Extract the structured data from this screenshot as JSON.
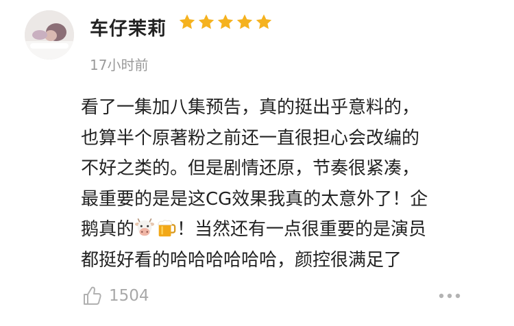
{
  "comment": {
    "username": "车仔茉莉",
    "rating": 5,
    "timestamp": "17小时前",
    "lines": [
      "看了一集加八集预告，真的挺出乎意料的，",
      "也算半个原著粉之前还一直很担心会改编的",
      "不好之类的。但是剧情还原，节奏很紧凑，",
      "最重要的是是这CG效果我真的太意外了！企"
    ],
    "line5_start": "鹅真的",
    "line5_end": "！当然还有一点很重要的是演员",
    "line6": "都挺好看的哈哈哈哈哈哈，颜控很满足了",
    "emojis": [
      "cow-face-icon",
      "beer-mug-icon"
    ],
    "likes": "1504"
  },
  "colors": {
    "star": "#f5b21f",
    "meta": "#9a9a9a",
    "text": "#222222"
  }
}
